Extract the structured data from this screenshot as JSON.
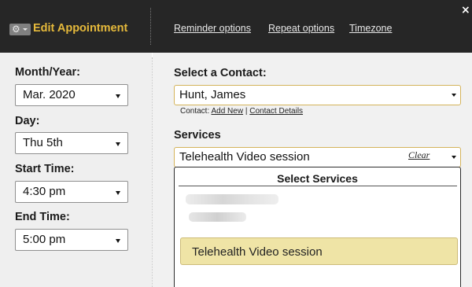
{
  "header": {
    "title": "Edit Appointment",
    "links": {
      "reminder": "Reminder options",
      "repeat": "Repeat options",
      "timezone": "Timezone"
    },
    "close_symbol": "×",
    "gear_symbol": "⚙"
  },
  "form": {
    "month_year": {
      "label": "Month/Year:",
      "value": "Mar. 2020"
    },
    "day": {
      "label": "Day:",
      "value": "Thu 5th"
    },
    "start_time": {
      "label": "Start Time:",
      "value": "4:30 pm"
    },
    "end_time": {
      "label": "End Time:",
      "value": "5:00 pm"
    }
  },
  "contact": {
    "label": "Select a Contact:",
    "value": "Hunt, James",
    "prefix": "Contact:",
    "add_new": "Add New",
    "separator": "|",
    "details": "Contact Details"
  },
  "services": {
    "label": "Services",
    "value": "Telehealth Video session",
    "clear": "Clear",
    "dropdown_title": "Select Services",
    "options": [
      "Telehealth Video session"
    ]
  },
  "colors": {
    "header_bg": "#262626",
    "title_accent": "#e5b93b",
    "highlight_option": "#efe4a6",
    "panel_bg": "#efefef"
  },
  "icons": {
    "gear": "gear-icon",
    "close": "close-icon",
    "dropdown": "chevron-down-icon"
  }
}
